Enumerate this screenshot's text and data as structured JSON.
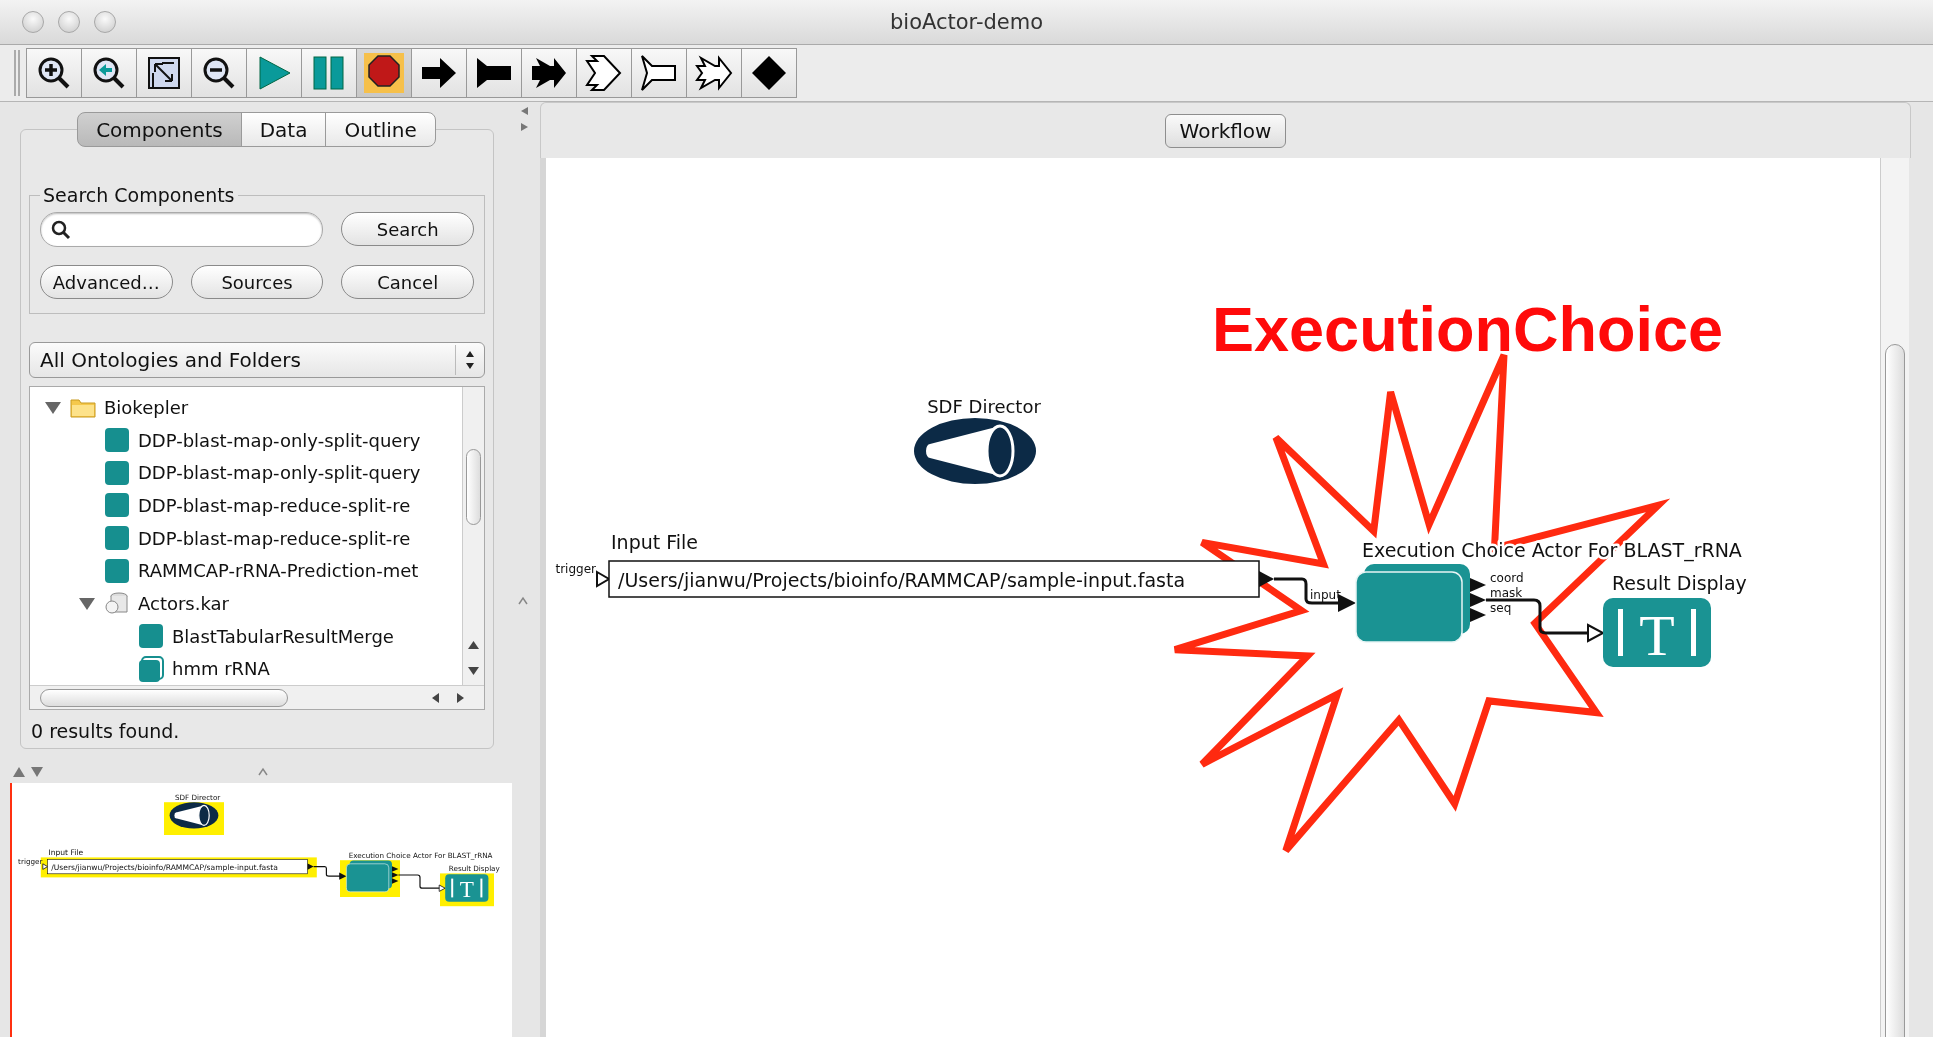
{
  "window": {
    "title": "bioActor-demo"
  },
  "toolbar": [
    {
      "kind": "zoom-in",
      "active": false
    },
    {
      "kind": "zoom-back",
      "active": false
    },
    {
      "kind": "fit",
      "active": false
    },
    {
      "kind": "zoom-out",
      "active": false
    },
    {
      "kind": "run",
      "active": false
    },
    {
      "kind": "pause",
      "active": false
    },
    {
      "kind": "stop",
      "active": true
    },
    {
      "kind": "arrow",
      "active": false
    },
    {
      "kind": "flag",
      "active": false
    },
    {
      "kind": "cross",
      "active": false
    },
    {
      "kind": "hollow-arrow",
      "active": false
    },
    {
      "kind": "hollow-flag",
      "active": false
    },
    {
      "kind": "hollow-cross",
      "active": false
    },
    {
      "kind": "diamond",
      "active": false
    }
  ],
  "left_panel": {
    "tabs": [
      {
        "label": "Components",
        "selected": true
      },
      {
        "label": "Data",
        "selected": false
      },
      {
        "label": "Outline",
        "selected": false
      }
    ],
    "search": {
      "legend": "Search Components",
      "buttons": [
        "Search",
        "Advanced…",
        "Sources",
        "Cancel"
      ]
    },
    "dropdown": {
      "value": "All Ontologies and Folders"
    },
    "tree": [
      {
        "label": "Biokepler",
        "kind": "folder",
        "expanded": true,
        "children": [
          {
            "label": "DDP-blast-map-only-split-query",
            "kind": "actor"
          },
          {
            "label": "DDP-blast-map-only-split-query",
            "kind": "actor"
          },
          {
            "label": "DDP-blast-map-reduce-split-re",
            "kind": "actor"
          },
          {
            "label": "DDP-blast-map-reduce-split-re",
            "kind": "actor"
          },
          {
            "label": "RAMMCAP-rRNA-Prediction-met",
            "kind": "actor"
          },
          {
            "label": "Actors.kar",
            "kind": "archive",
            "expanded": true,
            "children": [
              {
                "label": "BlastTabularResultMerge",
                "kind": "actor"
              },
              {
                "label": "hmm rRNA",
                "kind": "composite"
              }
            ]
          }
        ]
      }
    ],
    "status": "0 results found."
  },
  "minimap": {
    "director": "SDF Director",
    "input_file": {
      "label": "Input File",
      "port": "trigger",
      "value": "/Users/jianwu/Projects/bioinfo/RAMMCAP/sample-input.fasta"
    },
    "choice_actor": {
      "label": "Execution Choice Actor For BLAST_rRNA"
    },
    "result_display": {
      "label": "Result Display",
      "glyph": "T"
    }
  },
  "workflow": {
    "tab": "Workflow",
    "annotation": "ExecutionChoice",
    "director": "SDF Director",
    "input_file": {
      "label": "Input File",
      "port": "trigger",
      "value": "/Users/jianwu/Projects/bioinfo/RAMMCAP/sample-input.fasta"
    },
    "choice_actor": {
      "label": "Execution Choice Actor For BLAST_rRNA",
      "input": "input",
      "outputs": [
        "coord",
        "mask",
        "seq"
      ]
    },
    "result_display": {
      "label": "Result Display",
      "glyph": "T"
    }
  }
}
